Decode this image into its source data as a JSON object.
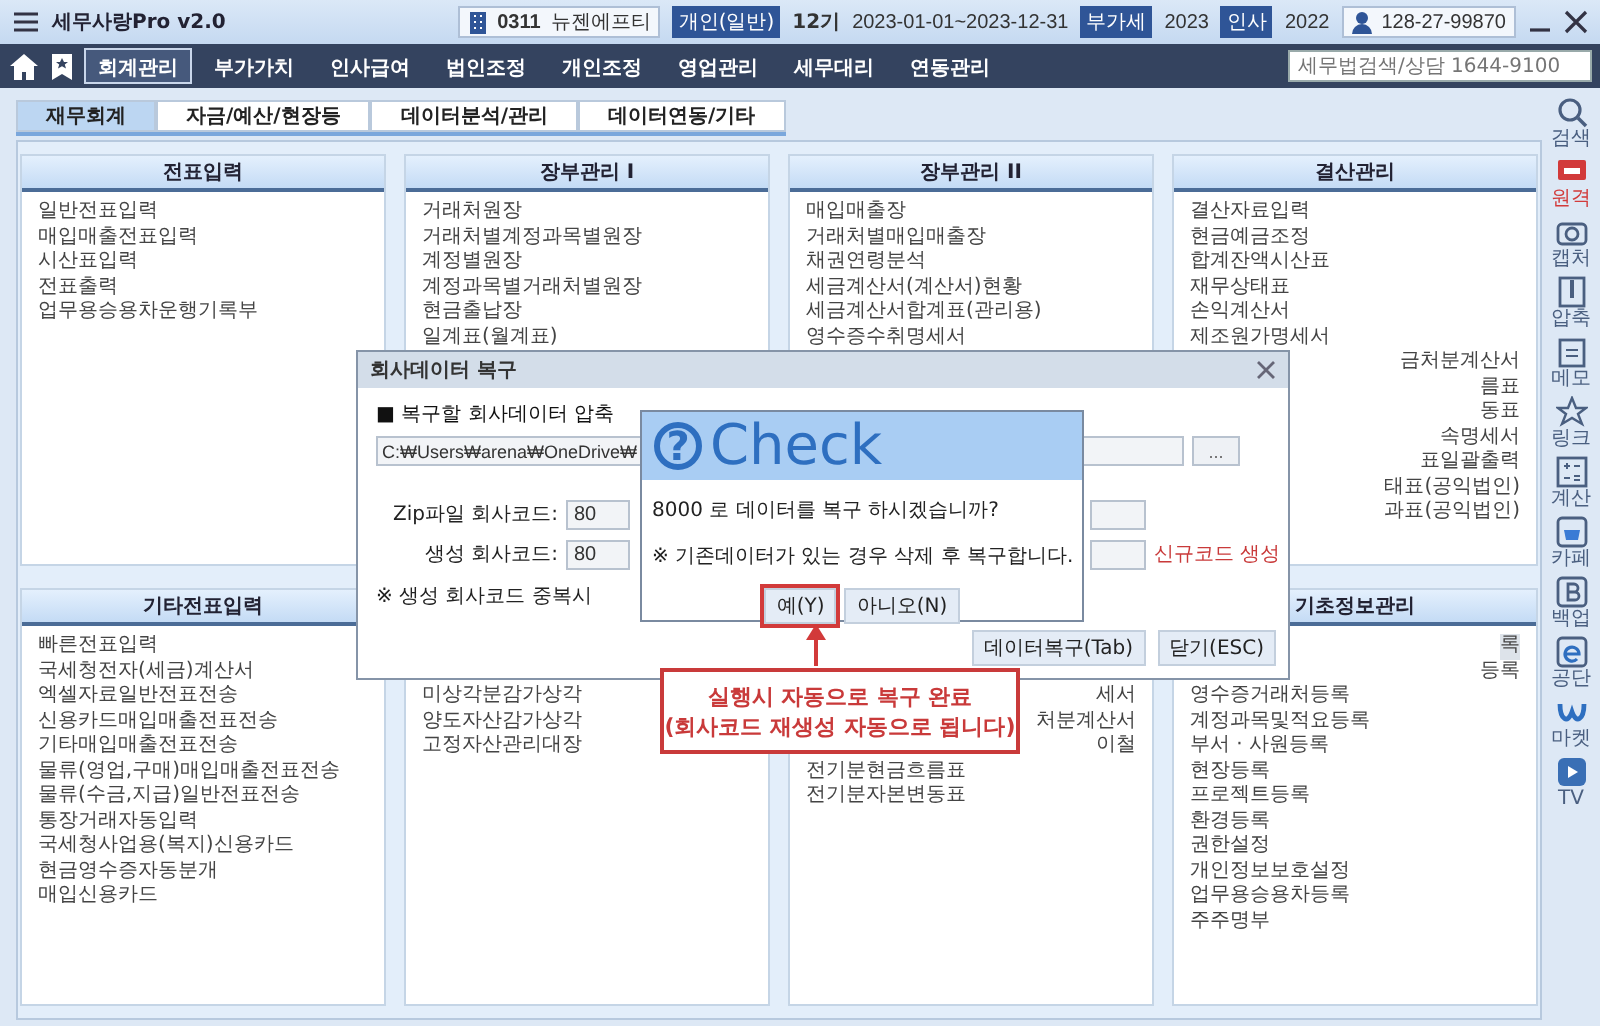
{
  "app": {
    "title": "세무사랑Pro v2.0"
  },
  "company": {
    "code": "0311",
    "name": "뉴젠에프티",
    "type": "개인(일반)",
    "term": "12기",
    "period": "2023-01-01~2023-12-31",
    "vat_label": "부가세",
    "vat_year": "2023",
    "hr_label": "인사",
    "hr_year": "2022",
    "business_no": "128-27-99870"
  },
  "menu": [
    {
      "label": "회계관리",
      "selected": true
    },
    {
      "label": "부가가치",
      "selected": false
    },
    {
      "label": "인사급여",
      "selected": false
    },
    {
      "label": "법인조정",
      "selected": false
    },
    {
      "label": "개인조정",
      "selected": false
    },
    {
      "label": "영업관리",
      "selected": false
    },
    {
      "label": "세무대리",
      "selected": false
    },
    {
      "label": "연동관리",
      "selected": false
    }
  ],
  "search": {
    "placeholder": "세무법검색/상담 1644-9100"
  },
  "subtabs": [
    {
      "label": "재무회계",
      "selected": true
    },
    {
      "label": "자금/예산/현장등",
      "selected": false
    },
    {
      "label": "데이터분석/관리",
      "selected": false
    },
    {
      "label": "데이터연동/기타",
      "selected": false
    }
  ],
  "panels": [
    {
      "title": "전표입력",
      "items": [
        {
          "label": "일반전표입력",
          "kind": "full"
        },
        {
          "label": "매입매출전표입력",
          "kind": "full"
        },
        {
          "label": "시산표입력",
          "kind": "full"
        },
        {
          "label": "전표출력",
          "kind": "full"
        },
        {
          "label": "업무용승용차운행기록부",
          "kind": "full"
        }
      ]
    },
    {
      "title": "장부관리 I",
      "items": [
        {
          "label": "거래처원장",
          "kind": "full"
        },
        {
          "label": "거래처별계정과목별원장",
          "kind": "full"
        },
        {
          "label": "계정별원장",
          "kind": "full"
        },
        {
          "label": "계정과목별거래처별원장",
          "kind": "full"
        },
        {
          "label": "현금출납장",
          "kind": "full"
        },
        {
          "label": "일계표(월계표)",
          "kind": "full"
        }
      ]
    },
    {
      "title": "장부관리 II",
      "items": [
        {
          "label": "매입매출장",
          "kind": "full"
        },
        {
          "label": "거래처별매입매출장",
          "kind": "full"
        },
        {
          "label": "채권연령분석",
          "kind": "full"
        },
        {
          "label": "세금계산서(계산서)현황",
          "kind": "full"
        },
        {
          "label": "세금계산서합계표(관리용)",
          "kind": "full"
        },
        {
          "label": "영수증수취명세서",
          "kind": "full"
        }
      ]
    },
    {
      "title": "결산관리",
      "items": [
        {
          "label": "결산자료입력",
          "kind": "full"
        },
        {
          "label": "현금예금조정",
          "kind": "full"
        },
        {
          "label": "합계잔액시산표",
          "kind": "full"
        },
        {
          "label": "재무상태표",
          "kind": "full"
        },
        {
          "label": "손익계산서",
          "kind": "full"
        },
        {
          "label": "제조원가명세서",
          "kind": "full"
        },
        {
          "label": "금처분계산서",
          "kind": "clipped"
        },
        {
          "label": "름표",
          "kind": "clipped"
        },
        {
          "label": "동표",
          "kind": "clipped"
        },
        {
          "label": "속명세서",
          "kind": "clipped"
        },
        {
          "label": "표일괄출력",
          "kind": "clipped"
        },
        {
          "label": "태표(공익법인)",
          "kind": "clipped"
        },
        {
          "label": "과표(공익법인)",
          "kind": "clipped"
        }
      ]
    },
    {
      "title": "기타전표입력",
      "items": [
        {
          "label": "빠른전표입력",
          "kind": "full"
        },
        {
          "label": "국세청전자(세금)계산서",
          "kind": "full"
        },
        {
          "label": "엑셀자료일반전표전송",
          "kind": "full"
        },
        {
          "label": "신용카드매입매출전표전송",
          "kind": "full"
        },
        {
          "label": "기타매입매출전표전송",
          "kind": "full"
        },
        {
          "label": "물류(영업,구매)매입매출전표전송",
          "kind": "full"
        },
        {
          "label": "물류(수금,지급)일반전표전송",
          "kind": "full"
        },
        {
          "label": "통장거래자동입력",
          "kind": "full"
        },
        {
          "label": "국세청사업용(복지)신용카드",
          "kind": "full"
        },
        {
          "label": "현금영수증자동분개",
          "kind": "full"
        },
        {
          "label": "매입신용카드",
          "kind": "full"
        }
      ]
    },
    {
      "items": [
        {
          "label": "미상각분감가상각",
          "kind": "full"
        },
        {
          "label": "양도자산감가상각",
          "kind": "full"
        },
        {
          "label": "고정자산관리대장",
          "kind": "full"
        }
      ]
    },
    {
      "items": [
        {
          "label": "세서",
          "kind": "clipped"
        },
        {
          "label": "처분계산서",
          "kind": "clipped"
        },
        {
          "label": "이철",
          "kind": "clipped"
        },
        {
          "label": "전기분현금흐름표",
          "kind": "full"
        },
        {
          "label": "전기분자본변동표",
          "kind": "full"
        }
      ]
    },
    {
      "title": "기초정보관리",
      "items": [
        {
          "label": "록",
          "kind": "clipped",
          "selected": true
        },
        {
          "label": "등록",
          "kind": "clipped",
          "selected": false
        },
        {
          "label": "영수증거래처등록",
          "kind": "full",
          "selected": false
        },
        {
          "label": "계정과목및적요등록",
          "kind": "full",
          "selected": false
        },
        {
          "label": "부서 · 사원등록",
          "kind": "full",
          "selected": false
        },
        {
          "label": "현장등록",
          "kind": "full",
          "selected": false
        },
        {
          "label": "프로젝트등록",
          "kind": "full",
          "selected": false
        },
        {
          "label": "환경등록",
          "kind": "full",
          "selected": false
        },
        {
          "label": "권한설정",
          "kind": "full",
          "selected": false
        },
        {
          "label": "개인정보보호설정",
          "kind": "full",
          "selected": false
        },
        {
          "label": "업무용승용차등록",
          "kind": "full",
          "selected": false
        },
        {
          "label": "주주명부",
          "kind": "full",
          "selected": false
        }
      ]
    }
  ],
  "sidebar": [
    {
      "label": "검색",
      "color": "#4a5f80"
    },
    {
      "label": "원격",
      "color": "#d23a3a"
    },
    {
      "label": "캡처",
      "color": "#4a5f80"
    },
    {
      "label": "압축",
      "color": "#4a5f80"
    },
    {
      "label": "메모",
      "color": "#4a5f80"
    },
    {
      "label": "링크",
      "color": "#4a5f80"
    },
    {
      "label": "계산",
      "color": "#4a5f80"
    },
    {
      "label": "카페",
      "color": "#4a5f80"
    },
    {
      "label": "백업",
      "color": "#4a5f80"
    },
    {
      "label": "공단",
      "color": "#4a5f80"
    },
    {
      "label": "마켓",
      "color": "#4a5f80"
    },
    {
      "label": "TV",
      "color": "#4a5f80"
    }
  ],
  "restore_dialog": {
    "title": "회사데이터 복구",
    "section": "■ 복구할 회사데이터 압축",
    "path": "C:₩Users₩arena₩OneDrive₩",
    "browse": "...",
    "fields": [
      {
        "label": "Zip파일 회사코드:",
        "value": "80"
      },
      {
        "label": "생성 회사코드:",
        "value": "80",
        "link": "신규코드 생성"
      }
    ],
    "note": "※ 생성 회사코드 중복시",
    "buttons": [
      "데이터복구(Tab)",
      "닫기(ESC)"
    ]
  },
  "confirm_dialog": {
    "icon": "?",
    "heading": "Check",
    "message": "8000 로 데이터를 복구 하시겠습니까?",
    "note": "※ 기존데이터가 있는 경우 삭제 후 복구합니다.",
    "buttons": [
      {
        "label": "예(Y)",
        "selected": true
      },
      {
        "label": "아니오(N)",
        "selected": false
      }
    ]
  },
  "callout": {
    "lines": [
      "실행시 자동으로 복구 완료",
      "(회사코드 재생성 자동으로 됩니다)"
    ]
  }
}
